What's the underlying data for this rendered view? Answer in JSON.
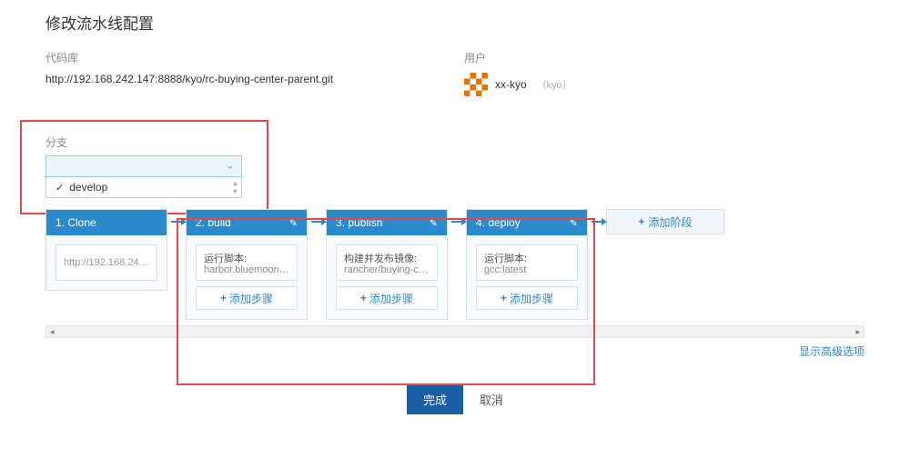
{
  "title": "修改流水线配置",
  "repo": {
    "label": "代码库",
    "url": "http://192.168.242.147:8888/kyo/rc-buying-center-parent.git"
  },
  "user": {
    "label": "用户",
    "name": "xx-kyo",
    "sub": "（kyo）"
  },
  "branch": {
    "label": "分支",
    "selected": "",
    "options": [
      "develop"
    ]
  },
  "pipeline": {
    "stages": [
      {
        "title": "1. Clone",
        "steps": [
          {
            "l1": "http://192.168.242.1...",
            "l2": ""
          }
        ],
        "showAddStep": false,
        "editable": false
      },
      {
        "title": "2. build",
        "steps": [
          {
            "l1": "运行脚本:",
            "l2": "harbor.bluemoon.c..."
          }
        ],
        "showAddStep": true,
        "editable": true
      },
      {
        "title": "3. publish",
        "steps": [
          {
            "l1": "构建并发布镜像:",
            "l2": "rancher/buying-ce..."
          }
        ],
        "showAddStep": true,
        "editable": true
      },
      {
        "title": "4. deploy",
        "steps": [
          {
            "l1": "运行脚本:",
            "l2": "gcc:latest"
          }
        ],
        "showAddStep": true,
        "editable": true
      }
    ],
    "addStepLabel": "添加步骤",
    "addStageLabel": "添加阶段"
  },
  "advancedLink": "显示高级选项",
  "buttons": {
    "done": "完成",
    "cancel": "取消"
  }
}
